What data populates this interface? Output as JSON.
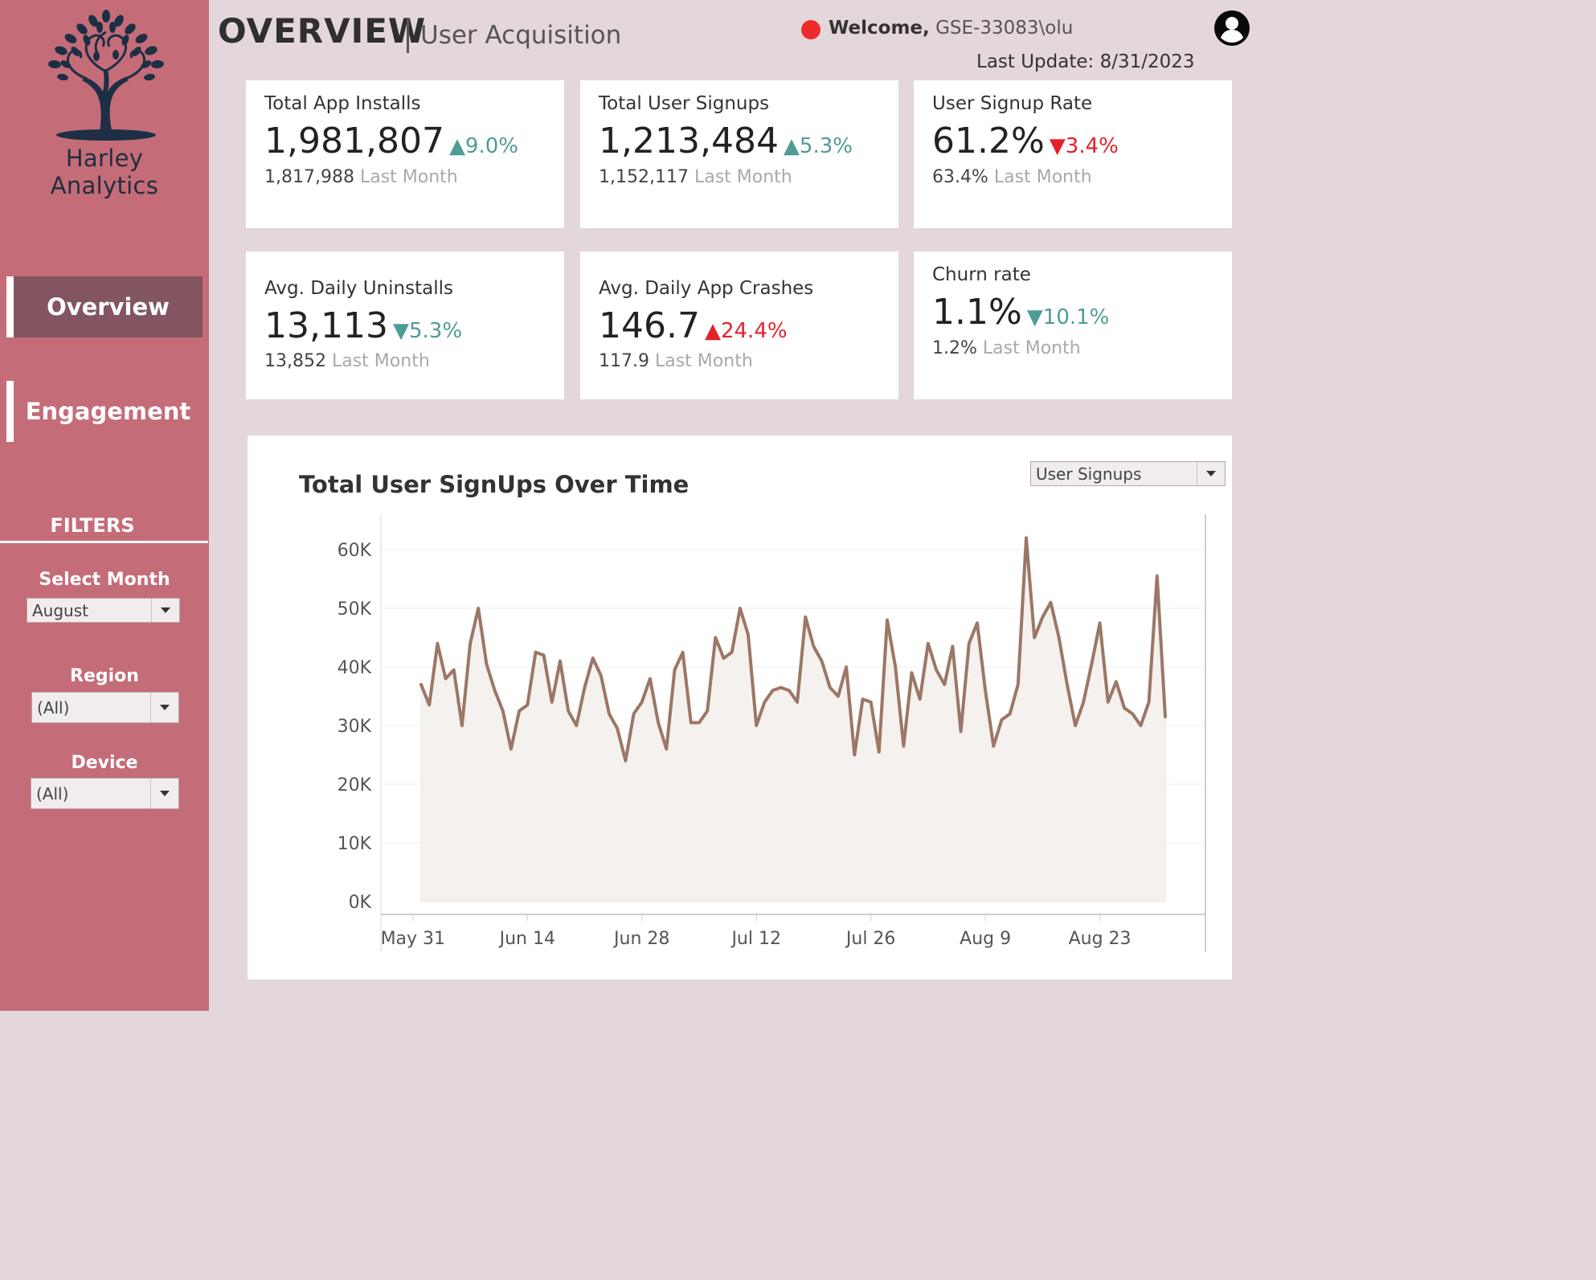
{
  "brand": {
    "name": "Harley Analytics"
  },
  "nav": {
    "items": [
      {
        "label": "Overview",
        "active": true
      },
      {
        "label": "Engagement",
        "active": false
      }
    ]
  },
  "filters": {
    "title": "FILTERS",
    "month": {
      "label": "Select Month",
      "value": "August"
    },
    "region": {
      "label": "Region",
      "value": "(All)"
    },
    "device": {
      "label": "Device",
      "value": "(All)"
    }
  },
  "header": {
    "title": "OVERVIEW",
    "subtitle": "User Acquisition",
    "welcome": "Welcome,",
    "user": "GSE-33083\\olu",
    "last_update": "Last Update: 8/31/2023",
    "status_color": "#ee2b2b"
  },
  "kpis": [
    {
      "title": "Total App Installs",
      "value": "1,981,807",
      "delta": "▲9.0%",
      "prev": "1,817,988",
      "prev_label": "Last Month"
    },
    {
      "title": "Total User Signups",
      "value": "1,213,484",
      "delta": "▲5.3%",
      "prev": "1,152,117",
      "prev_label": "Last Month"
    },
    {
      "title": "User Signup Rate",
      "value": "61.2%",
      "delta": "▼3.4%",
      "prev": "63.4%",
      "prev_label": "Last Month"
    },
    {
      "title": "Avg. Daily Uninstalls",
      "value": "13,113",
      "delta": "▼5.3%",
      "prev": "13,852",
      "prev_label": "Last Month"
    },
    {
      "title": "Avg. Daily App Crashes",
      "value": "146.7",
      "delta": "▲24.4%",
      "prev": "117.9",
      "prev_label": "Last Month"
    },
    {
      "title": "Churn rate",
      "value": "1.1%",
      "delta": "▼10.1%",
      "prev": "1.2%",
      "prev_label": "Last Month"
    }
  ],
  "colors": {
    "sidebar": "#c56c79",
    "nav_active": "#835560",
    "background": "#e4d7dc",
    "positive": "#4e9c96",
    "negative": "#e5202a",
    "line": "#9c7766",
    "area": "#f5f1ef"
  },
  "chart": {
    "title": "Total User SignUps Over Time",
    "metric_select": "User Signups"
  },
  "chart_data": {
    "type": "area",
    "title": "Total User SignUps Over Time",
    "x_start": "2023-06-01",
    "x_end": "2023-08-31",
    "x_ticks": [
      "May 31",
      "Jun 14",
      "Jun 28",
      "Jul 12",
      "Jul 26",
      "Aug 9",
      "Aug 23"
    ],
    "y_ticks": [
      "0K",
      "10K",
      "20K",
      "30K",
      "40K",
      "50K",
      "60K"
    ],
    "ylim": [
      0,
      65000
    ],
    "grid": true,
    "series": [
      {
        "values": [
          37000,
          33500,
          44000,
          38000,
          39500,
          30000,
          44000,
          50000,
          40500,
          36000,
          32500,
          26000,
          32500,
          33500,
          42500,
          42000,
          34000,
          41000,
          32500,
          30000,
          36500,
          41500,
          38500,
          32000,
          29500,
          24000,
          32000,
          34000,
          38000,
          30500,
          26000,
          39500,
          42500,
          30500,
          30500,
          32500,
          45000,
          41500,
          42500,
          50000,
          45500,
          30000,
          34000,
          36000,
          36500,
          36000,
          34000,
          48500,
          43500,
          41000,
          36500,
          35000,
          40000,
          25000,
          34500,
          34000,
          25500,
          48000,
          40000,
          26500,
          39000,
          34500,
          44000,
          39500,
          37000,
          43500,
          29000,
          44000,
          47500,
          36000,
          26500,
          31000,
          32000,
          37000,
          62000,
          45000,
          48500,
          51000,
          45000,
          37000,
          30000,
          34000,
          40500,
          47500,
          34000,
          37500,
          33000,
          32000,
          30000,
          34000,
          55500,
          31500
        ]
      }
    ]
  }
}
